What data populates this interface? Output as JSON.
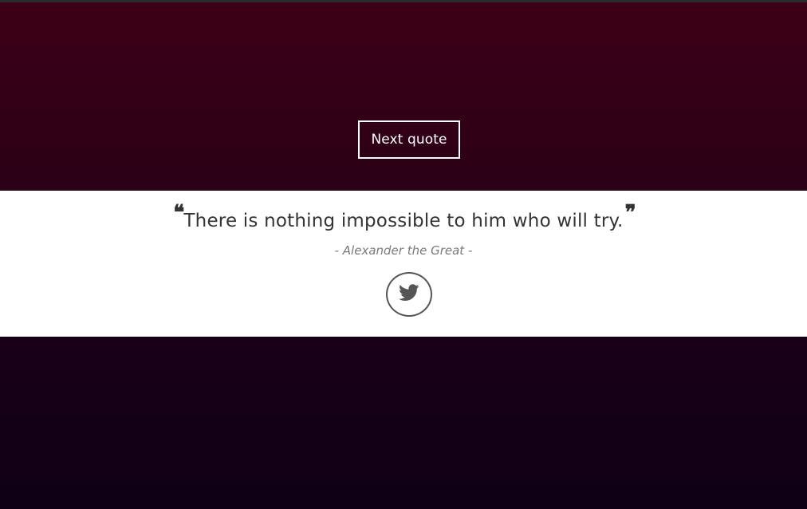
{
  "controls": {
    "next_quote_label": "Next quote"
  },
  "quote": {
    "open_mark": "❝",
    "text": "There is nothing impossible to him who will try.",
    "close_mark": "❞",
    "author": "- Alexander the Great -"
  },
  "share": {
    "icon": "twitter-bird-icon"
  },
  "colors": {
    "background_top": "#3d0016",
    "background_bottom": "#0f0015",
    "quote_band": "#ffffff",
    "text": "#333333",
    "author": "#7a7a7a",
    "button_border": "#ffffff"
  }
}
